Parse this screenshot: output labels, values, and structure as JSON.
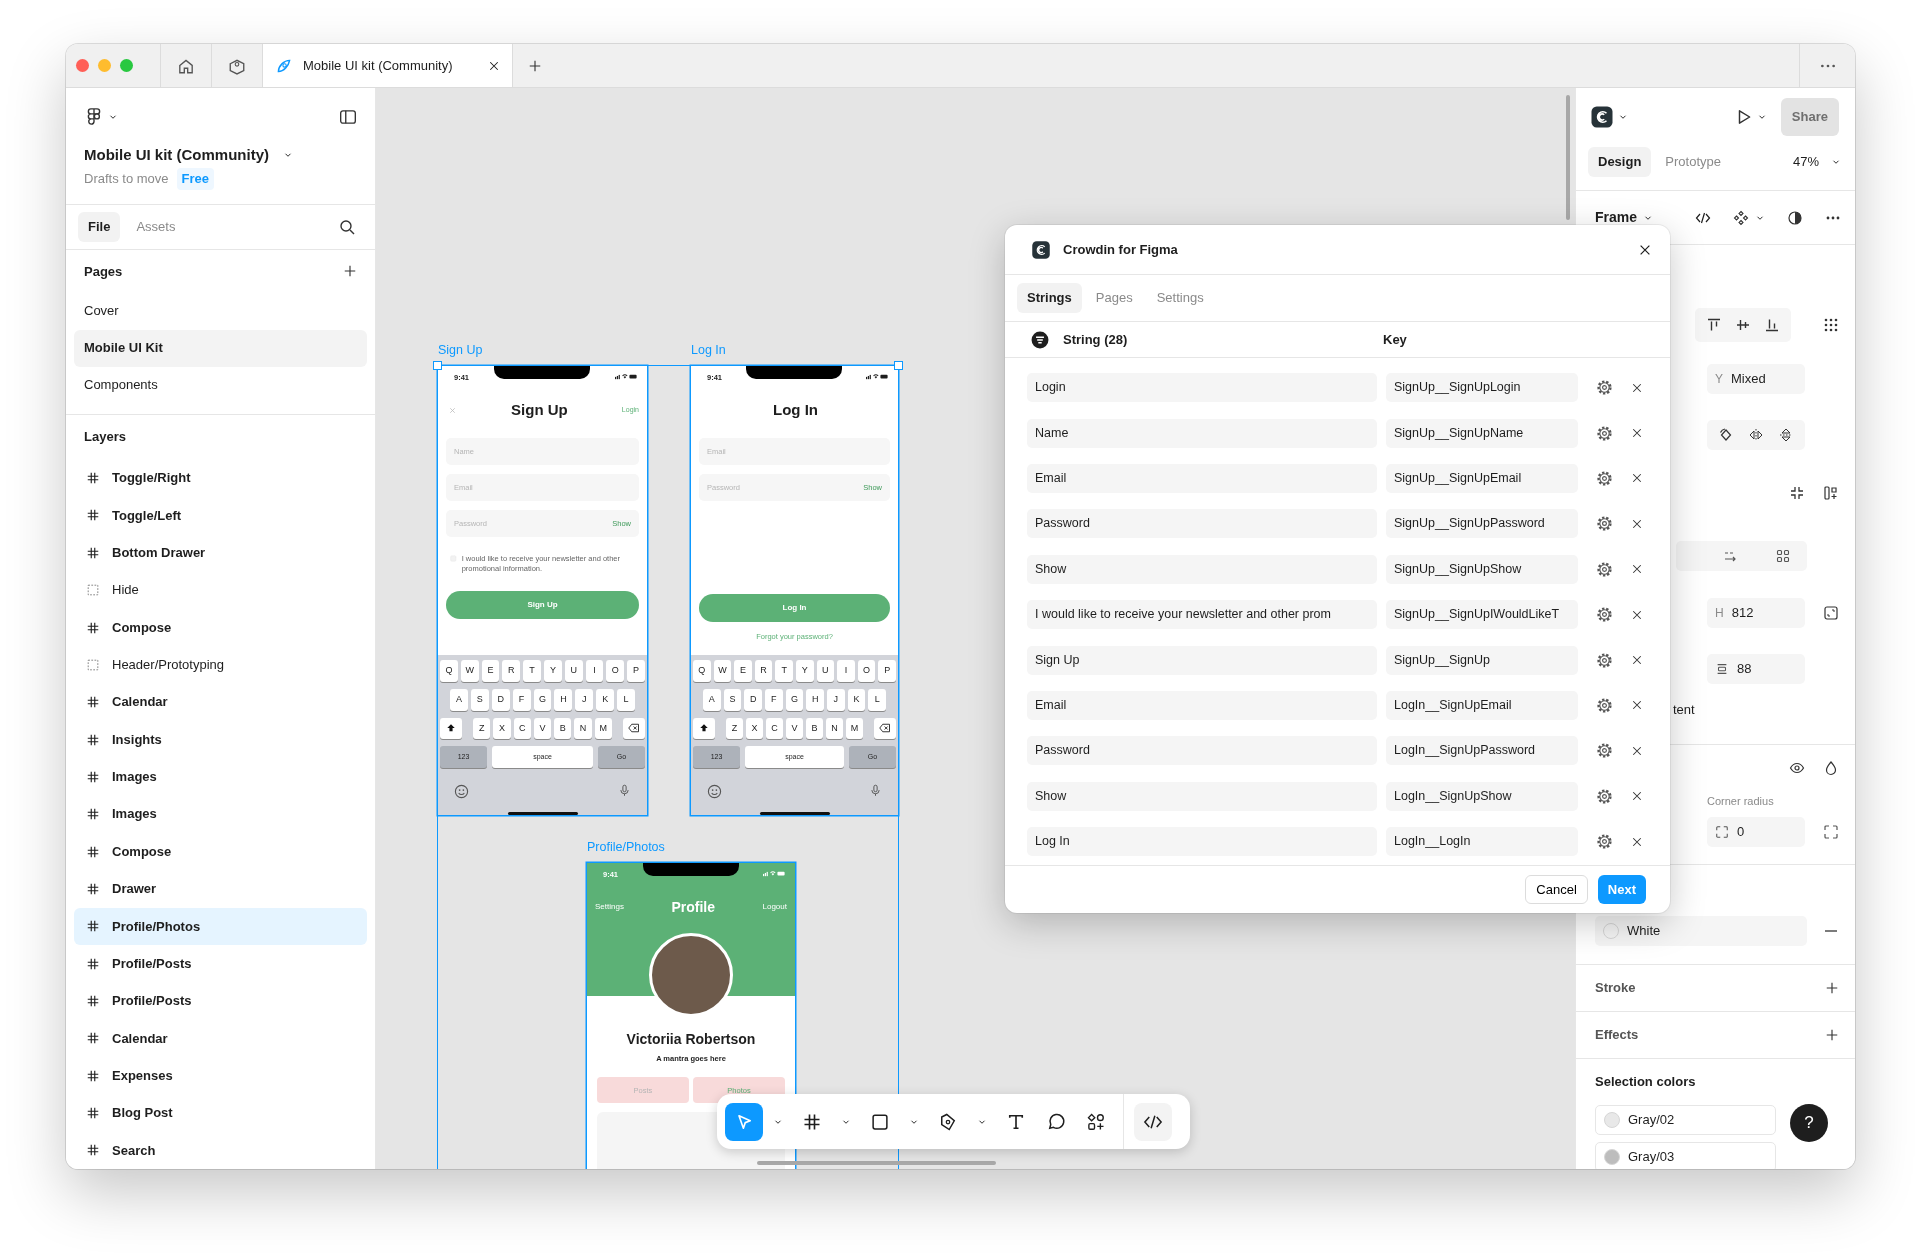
{
  "title_bar": {
    "tabs": [
      {
        "kind": "home",
        "selected": false
      },
      {
        "kind": "community",
        "selected": false
      },
      {
        "kind": "file",
        "label": "Mobile UI kit (Community)",
        "selected": true
      }
    ]
  },
  "sidebar": {
    "file_name": "Mobile UI kit (Community)",
    "location": "Drafts to move",
    "plan": "Free",
    "tabs": [
      {
        "label": "File",
        "selected": true
      },
      {
        "label": "Assets",
        "selected": false
      }
    ],
    "pages_heading": "Pages",
    "pages": [
      {
        "label": "Cover",
        "selected": false
      },
      {
        "label": "Mobile UI Kit",
        "selected": true
      },
      {
        "label": "Components",
        "selected": false
      }
    ],
    "layers_heading": "Layers",
    "layers": [
      {
        "label": "Toggle/Right",
        "kind": "frame",
        "selected": false
      },
      {
        "label": "Toggle/Left",
        "kind": "frame",
        "selected": false
      },
      {
        "label": "Bottom Drawer",
        "kind": "frame",
        "selected": false
      },
      {
        "label": "Hide",
        "kind": "group",
        "selected": false
      },
      {
        "label": "Compose",
        "kind": "frame",
        "selected": false
      },
      {
        "label": "Header/Prototyping",
        "kind": "group",
        "selected": false
      },
      {
        "label": "Calendar",
        "kind": "frame",
        "selected": false
      },
      {
        "label": "Insights",
        "kind": "frame",
        "selected": false
      },
      {
        "label": "Images",
        "kind": "frame",
        "selected": false
      },
      {
        "label": "Images",
        "kind": "frame",
        "selected": false
      },
      {
        "label": "Compose",
        "kind": "frame",
        "selected": false
      },
      {
        "label": "Drawer",
        "kind": "frame",
        "selected": false
      },
      {
        "label": "Profile/Photos",
        "kind": "frame",
        "selected": true
      },
      {
        "label": "Profile/Posts",
        "kind": "frame",
        "selected": false
      },
      {
        "label": "Profile/Posts",
        "kind": "frame",
        "selected": false
      },
      {
        "label": "Calendar",
        "kind": "frame",
        "selected": false
      },
      {
        "label": "Expenses",
        "kind": "frame",
        "selected": false
      },
      {
        "label": "Blog Post",
        "kind": "frame",
        "selected": false
      },
      {
        "label": "Search",
        "kind": "frame",
        "selected": false
      }
    ]
  },
  "canvas": {
    "frames": [
      {
        "kind": "signup",
        "label": "Sign Up",
        "time": "9:41",
        "title": "Sign Up",
        "link": "Login",
        "fields": [
          {
            "placeholder": "Name"
          },
          {
            "placeholder": "Email"
          },
          {
            "placeholder": "Password",
            "action": "Show"
          }
        ],
        "consent_checked": false,
        "consent": "I would like to receive your newsletter and other promotional information.",
        "button": "Sign Up",
        "keyboard": {
          "rows": [
            [
              "Q",
              "W",
              "E",
              "R",
              "T",
              "Y",
              "U",
              "I",
              "O",
              "P"
            ],
            [
              "A",
              "S",
              "D",
              "F",
              "G",
              "H",
              "J",
              "K",
              "L"
            ],
            [
              "Z",
              "X",
              "C",
              "V",
              "B",
              "N",
              "M"
            ]
          ],
          "numbers": "123",
          "space": "space",
          "go": "Go"
        }
      },
      {
        "kind": "login",
        "label": "Log In",
        "time": "9:41",
        "title": "Log In",
        "fields": [
          {
            "placeholder": "Email"
          },
          {
            "placeholder": "Password",
            "action": "Show"
          }
        ],
        "button": "Log In",
        "link": "Forgot your password?",
        "keyboard": {
          "rows": [
            [
              "Q",
              "W",
              "E",
              "R",
              "T",
              "Y",
              "U",
              "I",
              "O",
              "P"
            ],
            [
              "A",
              "S",
              "D",
              "F",
              "G",
              "H",
              "J",
              "K",
              "L"
            ],
            [
              "Z",
              "X",
              "C",
              "V",
              "B",
              "N",
              "M"
            ]
          ],
          "numbers": "123",
          "space": "space",
          "go": "Go"
        }
      },
      {
        "kind": "profile",
        "label": "Profile/Photos",
        "time": "9:41",
        "left_action": "Settings",
        "title": "Profile",
        "right_action": "Logout",
        "name": "Victoriia Robertson",
        "tagline": "A mantra goes here",
        "tabs": [
          {
            "label": "Posts",
            "selected": false
          },
          {
            "label": "Photos",
            "selected": true
          }
        ]
      }
    ]
  },
  "toolbar": {
    "tools": [
      {
        "kind": "move",
        "selected": true
      },
      {
        "kind": "frame",
        "selected": false
      },
      {
        "kind": "shape",
        "selected": false
      },
      {
        "kind": "pen",
        "selected": false
      },
      {
        "kind": "text",
        "selected": false
      },
      {
        "kind": "comment",
        "selected": false
      },
      {
        "kind": "actions",
        "selected": false
      },
      {
        "kind": "dev",
        "selected": false
      }
    ]
  },
  "dialog": {
    "title": "Crowdin for Figma",
    "tabs": [
      {
        "label": "Strings",
        "selected": true
      },
      {
        "label": "Pages",
        "selected": false
      },
      {
        "label": "Settings",
        "selected": false
      }
    ],
    "columns": [
      "String (28)",
      "Key"
    ],
    "rows": [
      {
        "string": "Login",
        "key": "SignUp__SignUpLogin"
      },
      {
        "string": "Name",
        "key": "SignUp__SignUpName"
      },
      {
        "string": "Email",
        "key": "SignUp__SignUpEmail"
      },
      {
        "string": "Password",
        "key": "SignUp__SignUpPassword"
      },
      {
        "string": "Show",
        "key": "SignUp__SignUpShow"
      },
      {
        "string": "I would like to receive your newsletter and other prom",
        "key": "SignUp__SignUpIWouldLikeT"
      },
      {
        "string": "Sign Up",
        "key": "SignUp__SignUp"
      },
      {
        "string": "Email",
        "key": "LogIn__SignUpEmail"
      },
      {
        "string": "Password",
        "key": "LogIn__SignUpPassword"
      },
      {
        "string": "Show",
        "key": "LogIn__SignUpShow"
      },
      {
        "string": "Log In",
        "key": "LogIn__LogIn"
      }
    ],
    "buttons": [
      {
        "label": "Cancel",
        "kind": "secondary"
      },
      {
        "label": "Next",
        "kind": "primary"
      }
    ]
  },
  "right_panel": {
    "share": {
      "label": "Share",
      "disabled": true
    },
    "tabs": [
      {
        "label": "Design",
        "selected": true
      },
      {
        "label": "Prototype",
        "selected": false
      }
    ],
    "zoom": "47%",
    "selection_type": "Frame",
    "y": {
      "label": "Y",
      "value": "Mixed"
    },
    "h": {
      "label": "H",
      "value": "812"
    },
    "gap": "88",
    "clip_fragment": "tent",
    "corner_radius": {
      "label": "Corner radius",
      "value": "0"
    },
    "fill": "White",
    "sections": [
      "Stroke",
      "Effects"
    ],
    "selection_colors": {
      "heading": "Selection colors",
      "items": [
        {
          "name": "Gray/02",
          "color": "#e8e8e8"
        },
        {
          "name": "Gray/03",
          "color": "#bdbdbd"
        }
      ]
    },
    "help": "?"
  }
}
